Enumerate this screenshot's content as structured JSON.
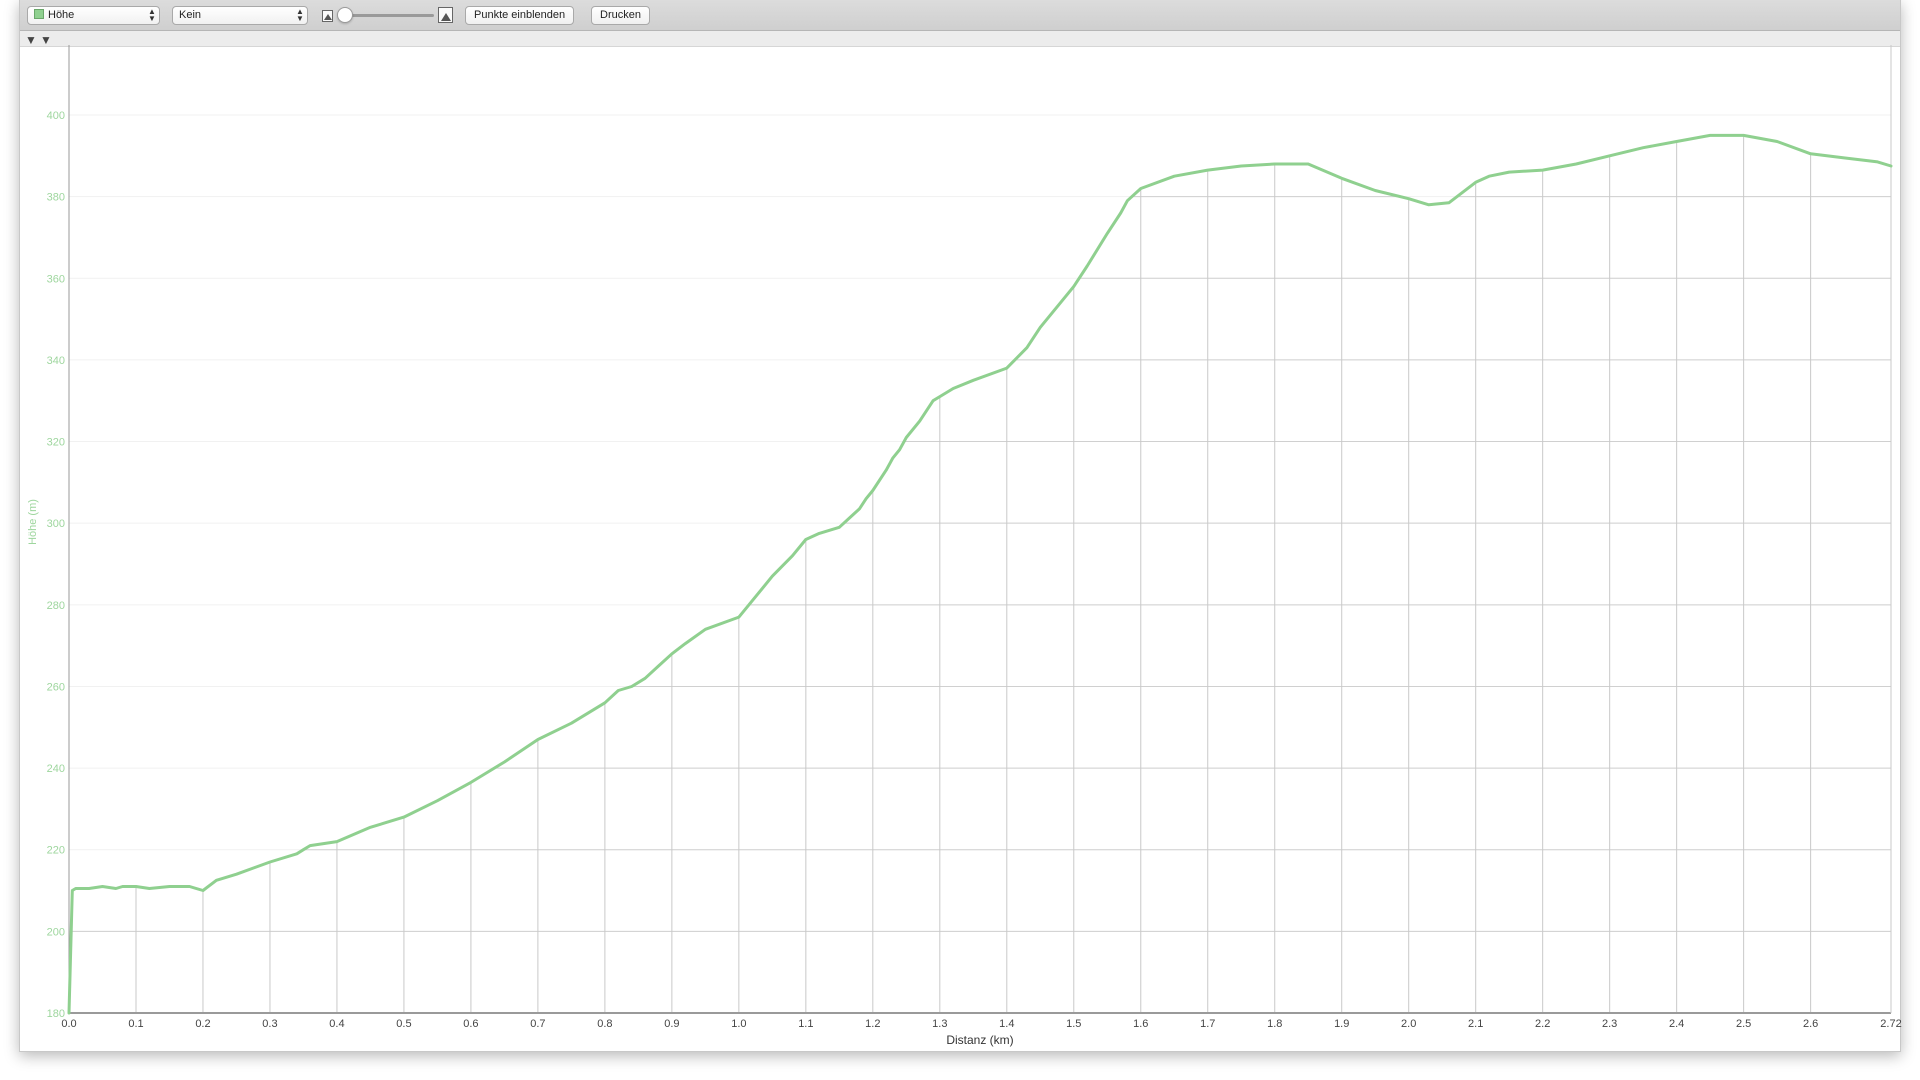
{
  "toolbar": {
    "series_select": "Höhe",
    "series_swatch_color": "#8fd08f",
    "overlay_select": "Kein",
    "show_points_button": "Punkte einblenden",
    "print_button": "Drucken",
    "zoom_level": 0.0,
    "collapse_icon_1": "triangle-down-icon",
    "collapse_icon_2": "triangle-down-icon"
  },
  "chart_data": {
    "type": "line",
    "xlabel": "Distanz (km)",
    "ylabel": "Höhe (m)",
    "xlim": [
      0.0,
      2.72
    ],
    "ylim": [
      180,
      400
    ],
    "x_ticks": [
      "0.0",
      "0.1",
      "0.2",
      "0.3",
      "0.4",
      "0.5",
      "0.6",
      "0.7",
      "0.8",
      "0.9",
      "1.0",
      "1.1",
      "1.2",
      "1.3",
      "1.4",
      "1.5",
      "1.6",
      "1.7",
      "1.8",
      "1.9",
      "2.0",
      "2.1",
      "2.2",
      "2.3",
      "2.4",
      "2.5",
      "2.6",
      "2.72"
    ],
    "y_ticks": [
      "180",
      "200",
      "220",
      "240",
      "260",
      "280",
      "300",
      "320",
      "340",
      "360",
      "380",
      "400"
    ],
    "grid": true,
    "line_color": "#8fd08f",
    "axis_label_color": "#9ed69e",
    "series": [
      {
        "x": [
          0.0,
          0.005,
          0.01,
          0.03,
          0.05,
          0.07,
          0.08,
          0.1,
          0.12,
          0.15,
          0.18,
          0.2,
          0.22,
          0.25,
          0.3,
          0.34,
          0.35,
          0.36,
          0.4,
          0.45,
          0.5,
          0.55,
          0.6,
          0.65,
          0.7,
          0.75,
          0.8,
          0.82,
          0.84,
          0.86,
          0.88,
          0.9,
          0.92,
          0.95,
          1.0,
          1.02,
          1.05,
          1.08,
          1.1,
          1.12,
          1.15,
          1.17,
          1.18,
          1.19,
          1.2,
          1.22,
          1.23,
          1.24,
          1.25,
          1.27,
          1.29,
          1.3,
          1.32,
          1.35,
          1.4,
          1.43,
          1.45,
          1.48,
          1.5,
          1.52,
          1.55,
          1.57,
          1.58,
          1.6,
          1.65,
          1.7,
          1.75,
          1.8,
          1.85,
          1.9,
          1.95,
          2.0,
          2.03,
          2.06,
          2.08,
          2.1,
          2.12,
          2.15,
          2.2,
          2.25,
          2.3,
          2.35,
          2.4,
          2.45,
          2.5,
          2.55,
          2.6,
          2.65,
          2.7,
          2.72
        ],
        "y": [
          180,
          210,
          210.5,
          210.5,
          211,
          210.5,
          211,
          211,
          210.5,
          211,
          211,
          210,
          212.5,
          214,
          217,
          219,
          220,
          221,
          222,
          225.5,
          228,
          232,
          236.5,
          241.5,
          247,
          251,
          256,
          259,
          260,
          262,
          265,
          268,
          270.5,
          274,
          277,
          281,
          287,
          292,
          296,
          297.5,
          299,
          302,
          303.5,
          306,
          308,
          313,
          316,
          318,
          321,
          325,
          330,
          331,
          333,
          335,
          338,
          343,
          348,
          354,
          358,
          363,
          371,
          376,
          379,
          382,
          385,
          386.5,
          387.5,
          388,
          388,
          384.5,
          381.5,
          379.5,
          378,
          378.5,
          381,
          383.5,
          385,
          386,
          386.5,
          388,
          390,
          392,
          393.5,
          395,
          395,
          393.5,
          390.5,
          389.5,
          388.5,
          387.5
        ]
      }
    ]
  }
}
